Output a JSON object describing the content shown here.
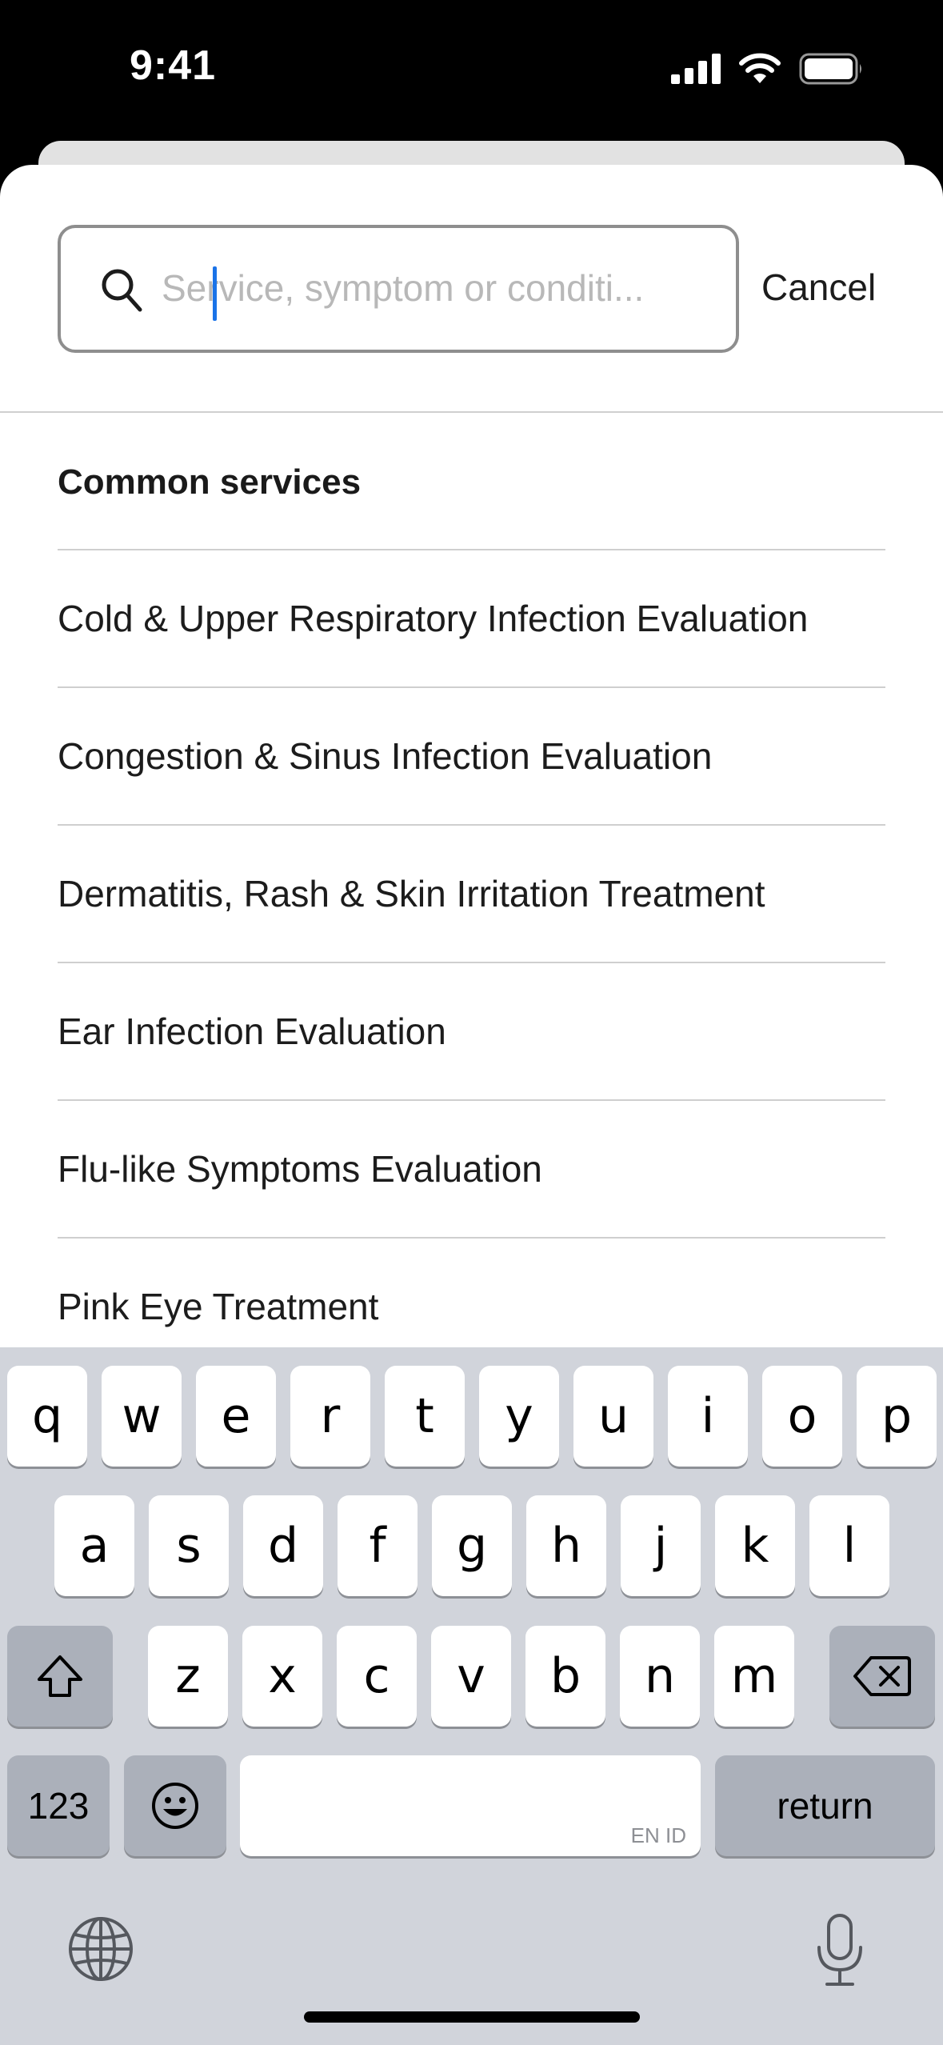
{
  "status_bar": {
    "time": "9:41"
  },
  "search": {
    "placeholder": "Service, symptom or conditi...",
    "value": "",
    "cancel_label": "Cancel"
  },
  "common_services": {
    "title": "Common services",
    "items": [
      "Cold & Upper Respiratory Infection Evaluation",
      "Congestion & Sinus Infection Evaluation",
      "Dermatitis, Rash & Skin Irritation Treatment",
      "Ear Infection Evaluation",
      "Flu-like Symptoms Evaluation",
      "Pink Eye Treatment"
    ]
  },
  "keyboard": {
    "row1": [
      "q",
      "w",
      "e",
      "r",
      "t",
      "y",
      "u",
      "i",
      "o",
      "p"
    ],
    "row2": [
      "a",
      "s",
      "d",
      "f",
      "g",
      "h",
      "j",
      "k",
      "l"
    ],
    "row3": [
      "z",
      "x",
      "c",
      "v",
      "b",
      "n",
      "m"
    ],
    "numbers_label": "123",
    "return_label": "return",
    "space_languages": "EN ID"
  },
  "colors": {
    "caret": "#1a73e8",
    "keyboard_bg": "#d1d4db",
    "key_bg": "#ffffff",
    "special_key_bg": "#abb0ba"
  },
  "icons": [
    "signal-icon",
    "wifi-icon",
    "battery-icon",
    "search-icon",
    "shift-icon",
    "backspace-icon",
    "emoji-icon",
    "globe-icon",
    "microphone-icon"
  ]
}
